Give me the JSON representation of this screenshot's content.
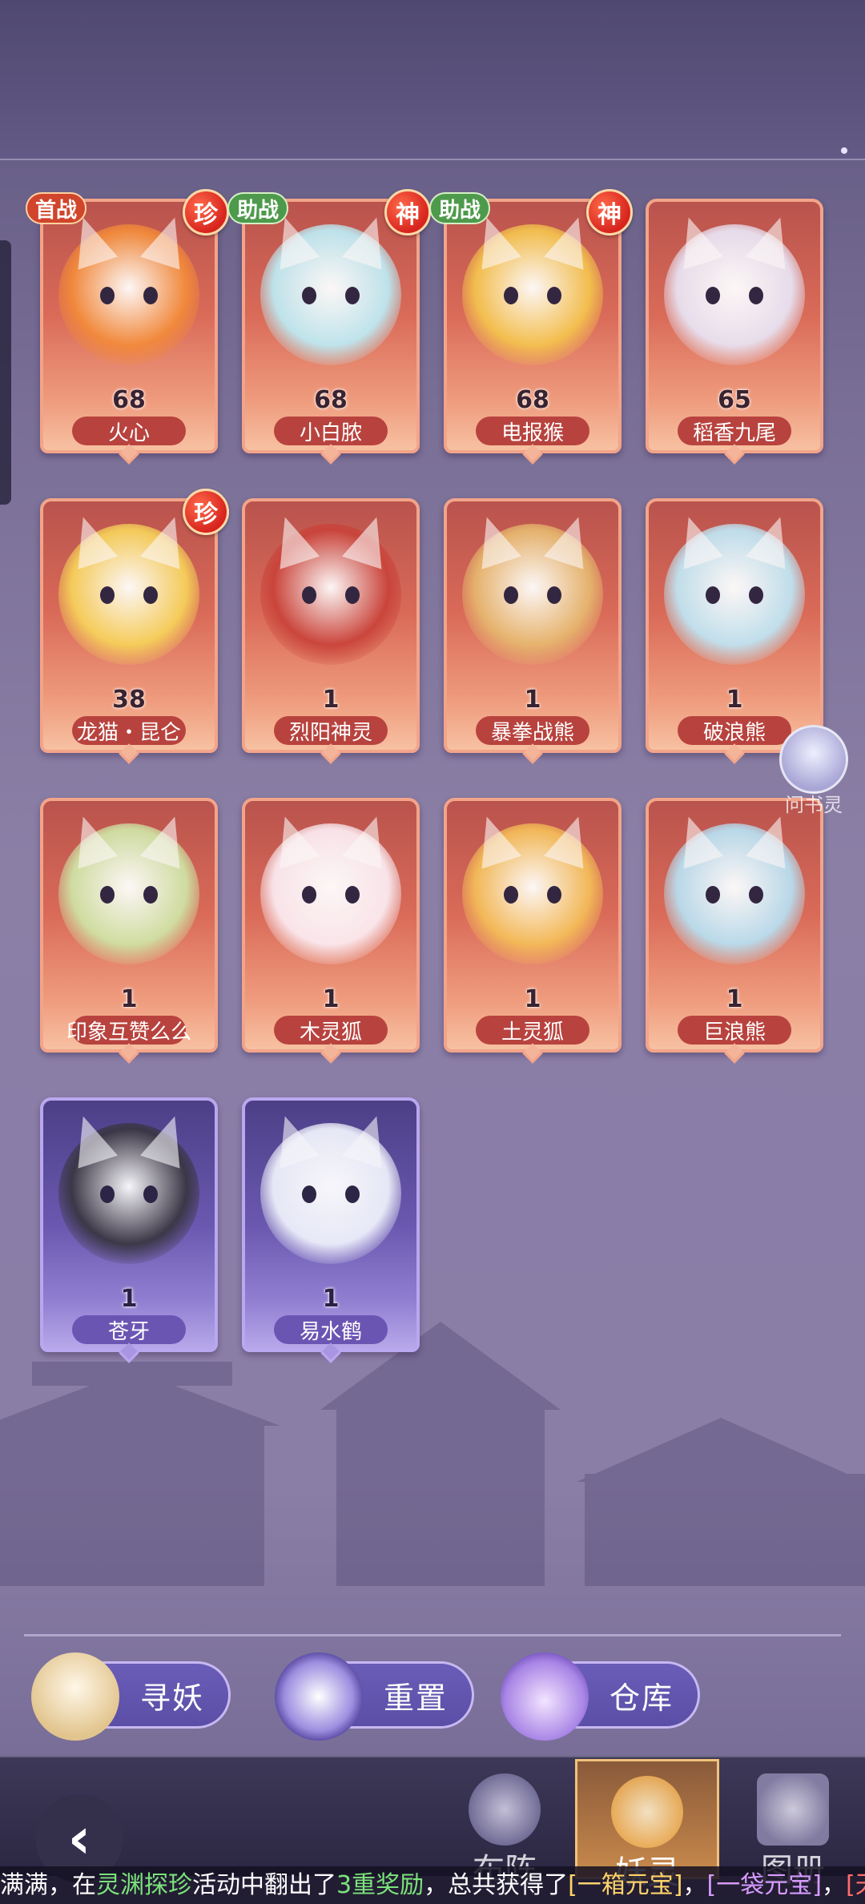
{
  "cards": [
    {
      "name": "火心",
      "level": "68",
      "frame": "red",
      "tag": "首战",
      "tag_color": "red",
      "rarity": "珍",
      "portrait_color": "#f28a3a"
    },
    {
      "name": "小白脓",
      "level": "68",
      "frame": "red",
      "tag": "助战",
      "tag_color": "green",
      "rarity": "神",
      "portrait_color": "#bde9f2"
    },
    {
      "name": "电报猴",
      "level": "68",
      "frame": "red",
      "tag": "助战",
      "tag_color": "green",
      "rarity": "神",
      "portrait_color": "#f4c24e"
    },
    {
      "name": "稻香九尾",
      "level": "65",
      "frame": "red",
      "tag": "",
      "tag_color": "",
      "rarity": "",
      "portrait_color": "#e8e2f2"
    },
    {
      "name": "龙猫・昆仑",
      "level": "38",
      "frame": "red",
      "tag": "",
      "tag_color": "",
      "rarity": "珍",
      "portrait_color": "#f6d05a"
    },
    {
      "name": "烈阳神灵",
      "level": "1",
      "frame": "red",
      "tag": "",
      "tag_color": "",
      "rarity": "",
      "portrait_color": "#c9433a"
    },
    {
      "name": "暴拳战熊",
      "level": "1",
      "frame": "red",
      "tag": "",
      "tag_color": "",
      "rarity": "",
      "portrait_color": "#e6b66e"
    },
    {
      "name": "破浪熊",
      "level": "1",
      "frame": "red",
      "tag": "",
      "tag_color": "",
      "rarity": "",
      "portrait_color": "#bfe4f2"
    },
    {
      "name": "印象互赞么么",
      "level": "1",
      "frame": "red",
      "tag": "",
      "tag_color": "",
      "rarity": "",
      "portrait_color": "#cfe2a4"
    },
    {
      "name": "木灵狐",
      "level": "1",
      "frame": "red",
      "tag": "",
      "tag_color": "",
      "rarity": "",
      "portrait_color": "#fbeaf0"
    },
    {
      "name": "土灵狐",
      "level": "1",
      "frame": "red",
      "tag": "",
      "tag_color": "",
      "rarity": "",
      "portrait_color": "#f4bc58"
    },
    {
      "name": "巨浪熊",
      "level": "1",
      "frame": "red",
      "tag": "",
      "tag_color": "",
      "rarity": "",
      "portrait_color": "#b8def0"
    },
    {
      "name": "苍牙",
      "level": "1",
      "frame": "purple",
      "tag": "",
      "tag_color": "",
      "rarity": "",
      "portrait_color": "#3a3642"
    },
    {
      "name": "易水鹤",
      "level": "1",
      "frame": "purple",
      "tag": "",
      "tag_color": "",
      "rarity": "",
      "portrait_color": "#eef0fb"
    }
  ],
  "float_npc": {
    "label": "问书灵"
  },
  "actions": {
    "seek": "寻妖",
    "reset": "重置",
    "warehouse": "仓库"
  },
  "nav": {
    "tab_formation": "布阵",
    "tab_spirits": "妖灵",
    "tab_album": "图册",
    "active": "妖灵"
  },
  "ticker": {
    "t1": "满满，在",
    "t2": "灵渊探珍",
    "t3": "活动中翻出了",
    "t4": "3重奖励",
    "t5": "，总共获得了",
    "t6": "[一箱元宝]",
    "t7": "，",
    "t8": "[一袋元宝]",
    "t9": "，",
    "t10": "[天霄"
  },
  "colors": {
    "frame_red": "#f2a48a",
    "frame_purple": "#b9a7ef",
    "accent_gold": "#f1c27a"
  }
}
